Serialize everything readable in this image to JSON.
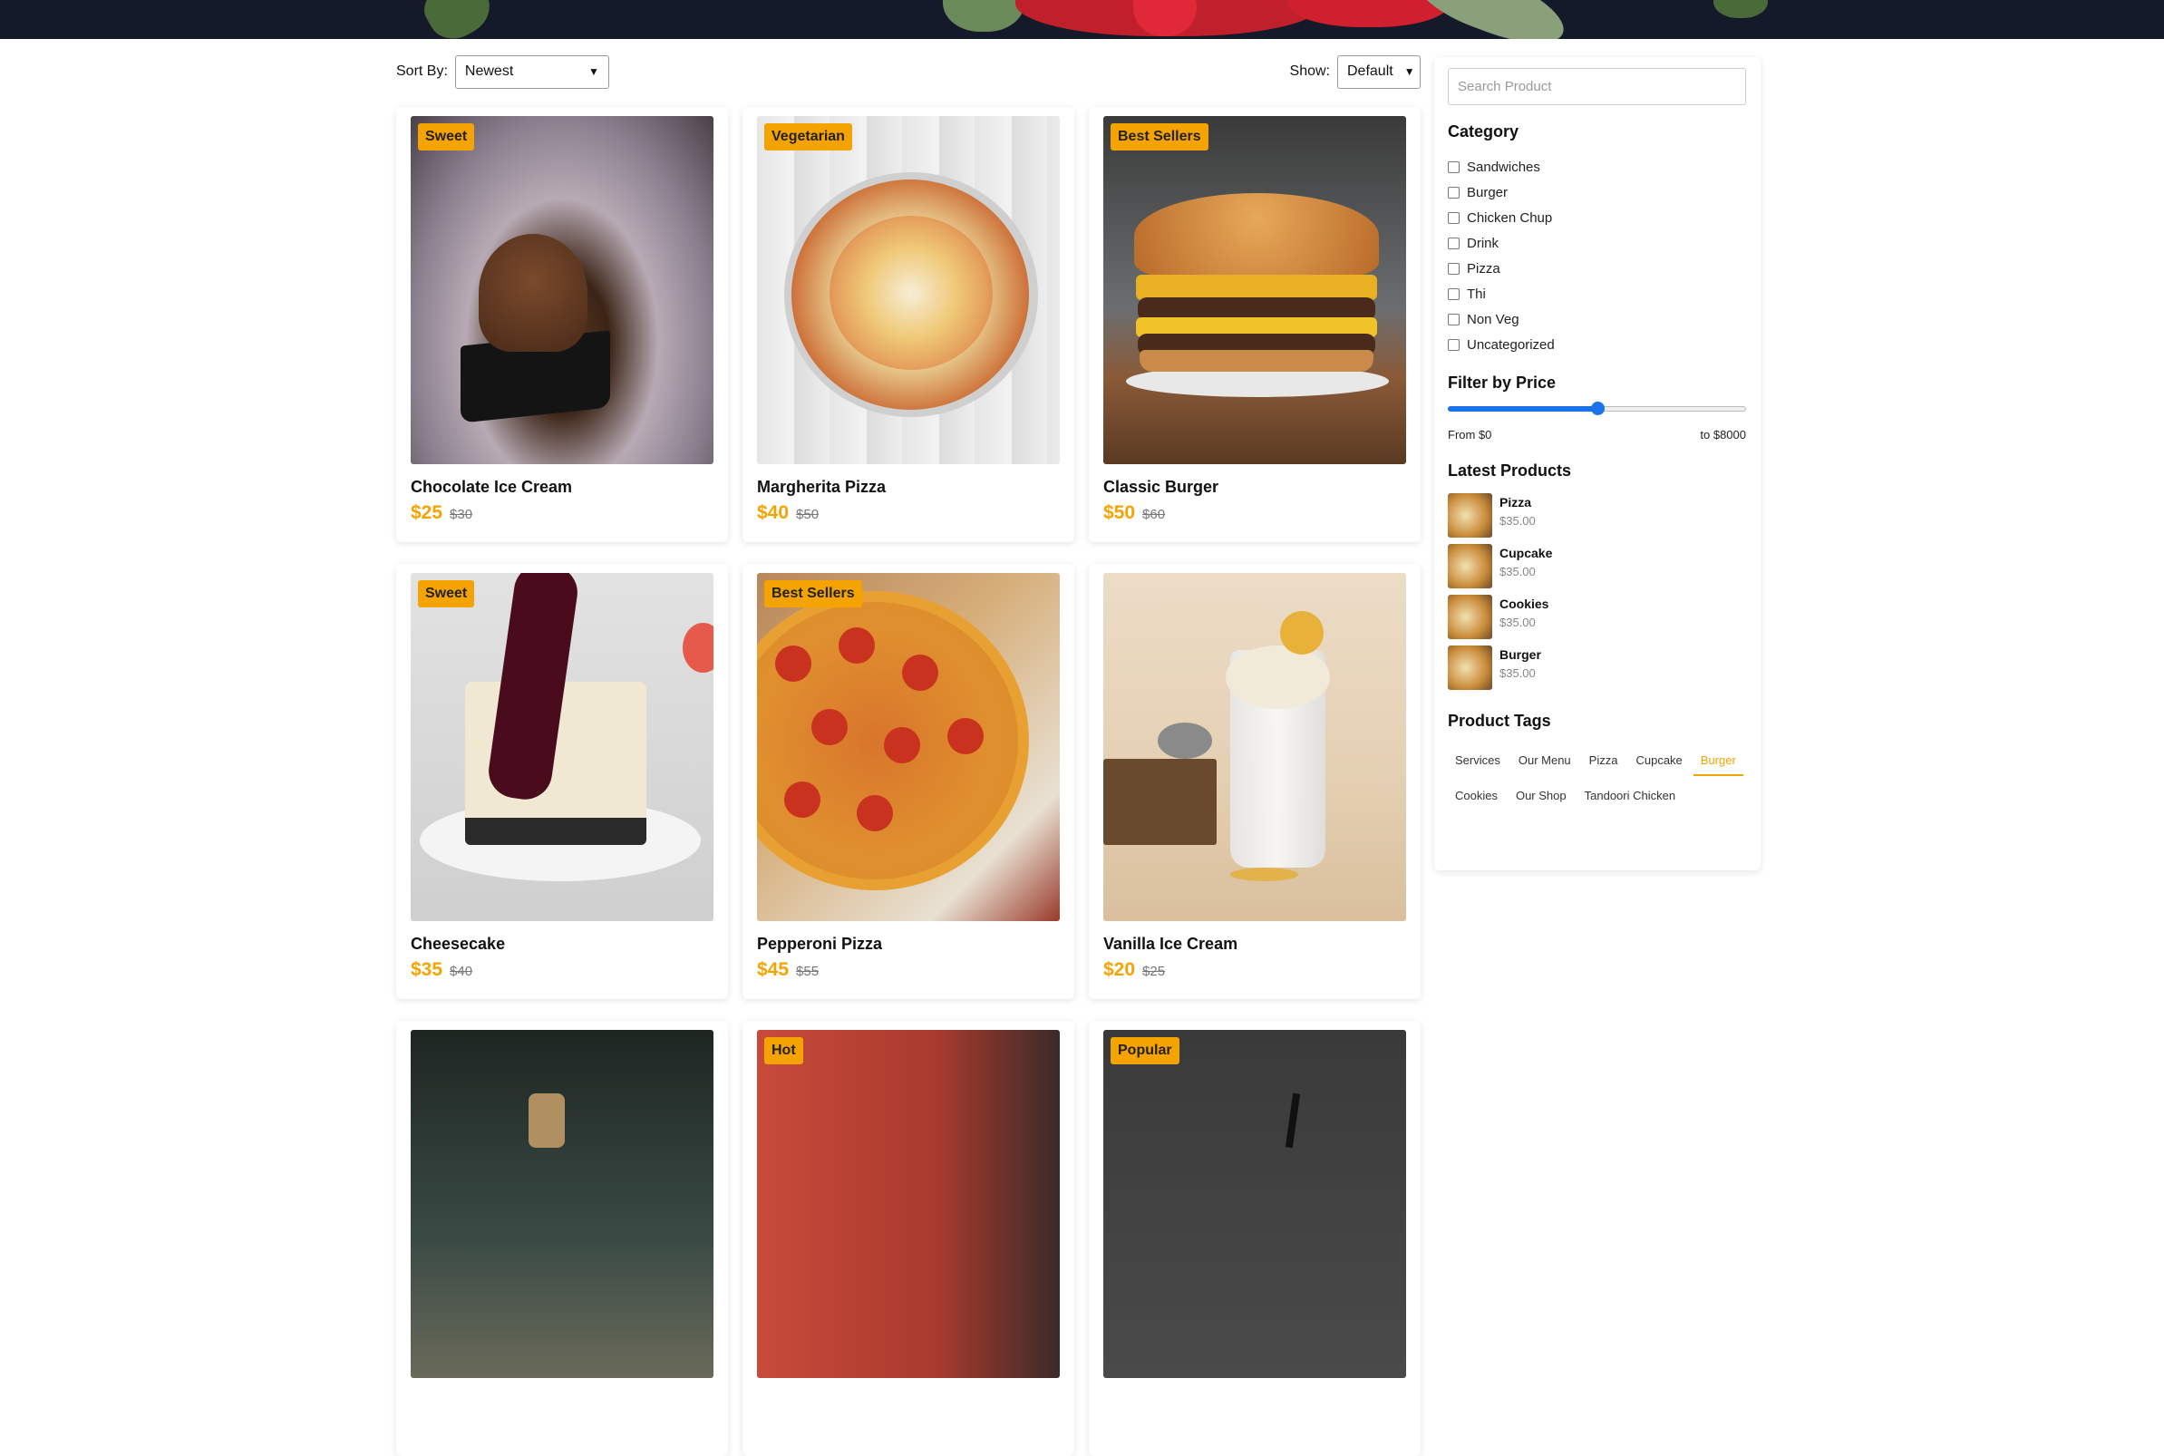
{
  "toolbar": {
    "sort_label": "Sort By:",
    "sort_value": "Newest",
    "show_label": "Show:",
    "show_value": "Default"
  },
  "products": [
    {
      "name": "Chocolate Ice Cream",
      "badge": "Sweet",
      "price": "$25",
      "old_price": "$30"
    },
    {
      "name": "Margherita Pizza",
      "badge": "Vegetarian",
      "price": "$40",
      "old_price": "$50"
    },
    {
      "name": "Classic Burger",
      "badge": "Best Sellers",
      "price": "$50",
      "old_price": "$60"
    },
    {
      "name": "Cheesecake",
      "badge": "Sweet",
      "price": "$35",
      "old_price": "$40"
    },
    {
      "name": "Pepperoni Pizza",
      "badge": "Best Sellers",
      "price": "$45",
      "old_price": "$55"
    },
    {
      "name": "Vanilla Ice Cream",
      "badge": "",
      "price": "$20",
      "old_price": "$25"
    },
    {
      "name": "",
      "badge": "",
      "price": "",
      "old_price": ""
    },
    {
      "name": "",
      "badge": "Hot",
      "price": "",
      "old_price": ""
    },
    {
      "name": "",
      "badge": "Popular",
      "price": "",
      "old_price": ""
    }
  ],
  "sidebar": {
    "search_placeholder": "Search Product",
    "category_title": "Category",
    "categories": [
      "Sandwiches",
      "Burger",
      "Chicken Chup",
      "Drink",
      "Pizza",
      "Thi",
      "Non Veg",
      "Uncategorized"
    ],
    "price_title": "Filter by Price",
    "price_from": "From $0",
    "price_to": "to $8000",
    "price_slider_fraction": 0.5,
    "latest_title": "Latest Products",
    "latest": [
      {
        "name": "Pizza",
        "price": "$35.00"
      },
      {
        "name": "Cupcake",
        "price": "$35.00"
      },
      {
        "name": "Cookies",
        "price": "$35.00"
      },
      {
        "name": "Burger",
        "price": "$35.00"
      }
    ],
    "tags_title": "Product Tags",
    "tags": [
      "Services",
      "Our Menu",
      "Pizza",
      "Cupcake",
      "Burger",
      "Cookies",
      "Our Shop",
      "Tandoori Chicken"
    ],
    "active_tag": "Burger"
  },
  "colors": {
    "accent": "#f5a300",
    "slider": "#1a73e8",
    "banner": "#141a2a"
  }
}
